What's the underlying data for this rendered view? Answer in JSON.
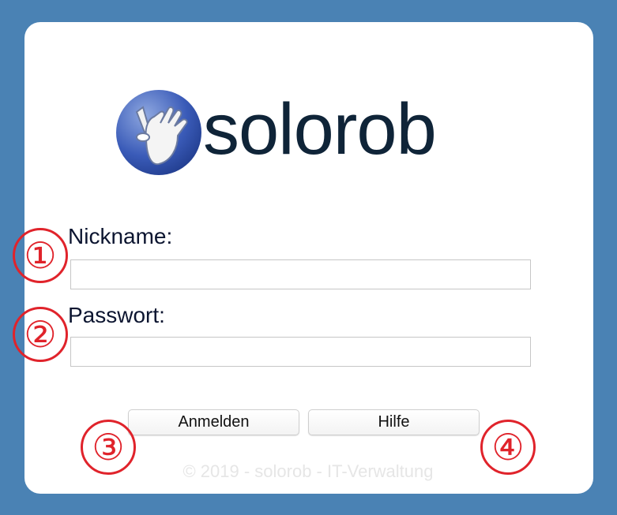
{
  "brand": {
    "name": "solorob",
    "logo_icon": "hand-icon",
    "colors": {
      "background": "#4a82b4",
      "card": "#ffffff",
      "logo_text": "#0f2438",
      "marker": "#e0232b"
    }
  },
  "form": {
    "nickname_label": "Nickname:",
    "nickname_value": "",
    "password_label": "Passwort:",
    "password_value": ""
  },
  "buttons": {
    "login_label": "Anmelden",
    "help_label": "Hilfe"
  },
  "footer": {
    "copyright": "© 2019 - solorob - IT-Verwaltung"
  },
  "annotations": {
    "marker_1": "①",
    "marker_2": "②",
    "marker_3": "③",
    "marker_4": "④"
  }
}
